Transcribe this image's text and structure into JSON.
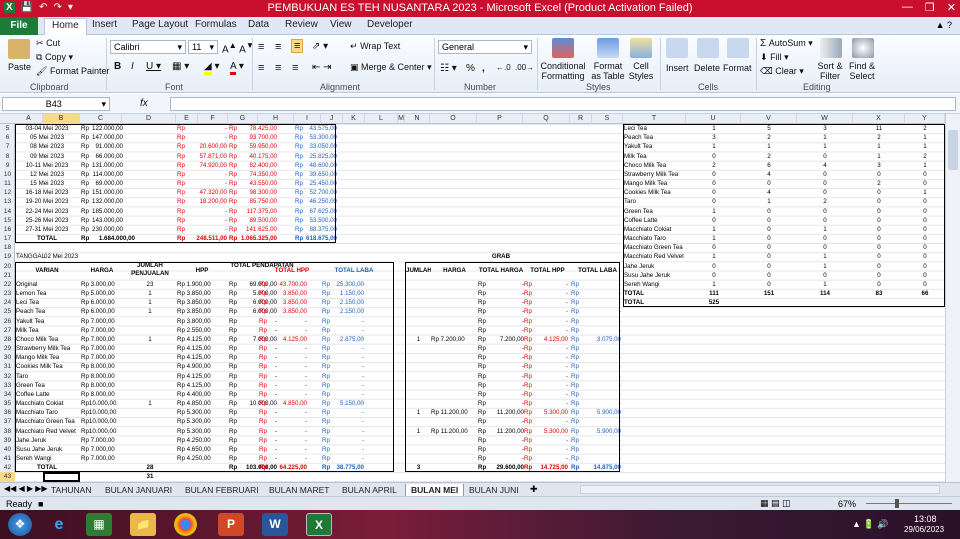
{
  "titlebar": {
    "title": "PEMBUKUAN ES TEH NUSANTARA 2023  -  Microsoft Excel (Product Activation Failed)"
  },
  "ribbon_tabs": [
    "File",
    "Home",
    "Insert",
    "Page Layout",
    "Formulas",
    "Data",
    "Review",
    "View",
    "Developer"
  ],
  "clipboard": {
    "paste": "Paste",
    "cut": "Cut",
    "copy": "Copy",
    "format_painter": "Format Painter",
    "label": "Clipboard"
  },
  "font": {
    "name": "Calibri",
    "size": "11",
    "label": "Font"
  },
  "alignment": {
    "wrap": "Wrap Text",
    "merge": "Merge & Center",
    "label": "Alignment"
  },
  "number": {
    "format": "General",
    "label": "Number"
  },
  "styles": {
    "cond": "Conditional Formatting",
    "table": "Format as Table",
    "cell": "Cell Styles",
    "label": "Styles"
  },
  "cells": {
    "insert": "Insert",
    "delete": "Delete",
    "format": "Format",
    "label": "Cells"
  },
  "editing": {
    "autosum": "AutoSum",
    "fill": "Fill",
    "clear": "Clear",
    "sort": "Sort & Filter",
    "find": "Find & Select",
    "label": "Editing"
  },
  "formula_bar": {
    "name_box": "B43",
    "fx": "fx",
    "content": ""
  },
  "columns": [
    "A",
    "B",
    "C",
    "D",
    "E",
    "F",
    "G",
    "H",
    "I",
    "J",
    "K",
    "L",
    "M",
    "N",
    "O",
    "P",
    "Q",
    "R",
    "S",
    "T",
    "U",
    "V",
    "W",
    "X",
    "Y"
  ],
  "rows": [
    "5",
    "6",
    "7",
    "8",
    "9",
    "10",
    "11",
    "12",
    "13",
    "14",
    "15",
    "16",
    "17",
    "18",
    "19",
    "20",
    "21",
    "22",
    "23",
    "24",
    "25",
    "26",
    "27",
    "28",
    "29",
    "30",
    "31",
    "32",
    "33",
    "34",
    "35",
    "36",
    "37",
    "38",
    "39",
    "40",
    "41",
    "42",
    "43"
  ],
  "top_table": [
    {
      "date": "03-04 Mei 2023",
      "a": "122.000,00",
      "b": "-",
      "c": "78.425,00",
      "d": "43.575,00"
    },
    {
      "date": "05 Mei 2023",
      "a": "147.000,00",
      "b": "-",
      "c": "93.700,00",
      "d": "53.300,00"
    },
    {
      "date": "08 Mei 2023",
      "a": "91.000,00",
      "b": "20.600,00",
      "c": "59.950,00",
      "d": "33.050,00"
    },
    {
      "date": "09 Mei 2023",
      "a": "66.000,00",
      "b": "57.871,00",
      "c": "40.175,00",
      "d": "25.825,00"
    },
    {
      "date": "10-11 Mei 2023",
      "a": "131.000,00",
      "b": "74.920,00",
      "c": "82.400,00",
      "d": "48.600,00"
    },
    {
      "date": "12 Mei 2023",
      "a": "114.000,00",
      "b": "-",
      "c": "74.350,00",
      "d": "39.650,00"
    },
    {
      "date": "15 Mei 2023",
      "a": "69.000,00",
      "b": "-",
      "c": "43.550,00",
      "d": "25.450,00"
    },
    {
      "date": "16-18 Mei 2023",
      "a": "151.000,00",
      "b": "47.320,00",
      "c": "98.300,00",
      "d": "52.700,00"
    },
    {
      "date": "19-20 Mei 2023",
      "a": "132.000,00",
      "b": "18.200,00",
      "c": "85.750,00",
      "d": "46.250,00"
    },
    {
      "date": "22-24 Mei 2023",
      "a": "185.000,00",
      "b": "-",
      "c": "117.375,00",
      "d": "67.625,00"
    },
    {
      "date": "25-26 Mei 2023",
      "a": "143.000,00",
      "b": "-",
      "c": "89.500,00",
      "d": "53.500,00"
    },
    {
      "date": "27-31 Mei 2023",
      "a": "230.000,00",
      "b": "-",
      "c": "141.625,00",
      "d": "88.375,00"
    }
  ],
  "top_total": {
    "label": "TOTAL",
    "a": "1.684.000,00",
    "b": "248.511,00",
    "c": "1.065.325,00",
    "d": "618.675,00"
  },
  "rp": "Rp",
  "tanggal": {
    "label": "TANGGAL",
    "value": "02 Mei 2023"
  },
  "grab_title": "GRAB",
  "headers": {
    "varian": "VARIAN",
    "harga": "HARGA",
    "jumlah": "JUMLAH PENJUALAN",
    "hpp": "HPP",
    "total_pend": "TOTAL PENDAPATAN",
    "total_hpp": "TOTAL HPP",
    "total_laba": "TOTAL LABA",
    "g_jumlah": "JUMLAH",
    "g_harga": "HARGA",
    "g_total_harga": "TOTAL HARGA",
    "g_total_hpp": "TOTAL HPP",
    "g_total_laba": "TOTAL LABA"
  },
  "items": [
    {
      "v": "Original",
      "h": "Rp  3.000,00",
      "j": "23",
      "hpp": "Rp  1.900,00",
      "tp": "69.000,00",
      "th": "43.700,00",
      "tl": "25.300,00",
      "gj": "",
      "gh": "",
      "gth": "-",
      "gthpp": "-",
      "gtl": "-"
    },
    {
      "v": "Lemon Tea",
      "h": "Rp  5.000,00",
      "j": "1",
      "hpp": "Rp  3.850,00",
      "tp": "5.000,00",
      "th": "3.850,00",
      "tl": "1.150,00",
      "gj": "",
      "gh": "",
      "gth": "-",
      "gthpp": "-",
      "gtl": "-"
    },
    {
      "v": "Leci Tea",
      "h": "Rp  6.000,00",
      "j": "1",
      "hpp": "Rp  3.850,00",
      "tp": "6.000,00",
      "th": "3.850,00",
      "tl": "2.150,00",
      "gj": "",
      "gh": "",
      "gth": "-",
      "gthpp": "-",
      "gtl": "-"
    },
    {
      "v": "Peach Tea",
      "h": "Rp  6.000,00",
      "j": "1",
      "hpp": "Rp  3.850,00",
      "tp": "6.000,00",
      "th": "3.850,00",
      "tl": "2.150,00",
      "gj": "",
      "gh": "",
      "gth": "-",
      "gthpp": "-",
      "gtl": "-"
    },
    {
      "v": "Yakult Tea",
      "h": "Rp  7.000,00",
      "j": "",
      "hpp": "Rp  3.800,00",
      "tp": "-",
      "th": "-",
      "tl": "-",
      "gj": "",
      "gh": "",
      "gth": "-",
      "gthpp": "-",
      "gtl": "-"
    },
    {
      "v": "Milk Tea",
      "h": "Rp  7.000,00",
      "j": "",
      "hpp": "Rp  2.550,00",
      "tp": "-",
      "th": "-",
      "tl": "-",
      "gj": "",
      "gh": "",
      "gth": "-",
      "gthpp": "-",
      "gtl": "-"
    },
    {
      "v": "Choco Milk Tea",
      "h": "Rp  7.000,00",
      "j": "1",
      "hpp": "Rp  4.125,00",
      "tp": "7.000,00",
      "th": "4.125,00",
      "tl": "2.875,00",
      "gj": "1",
      "gh": "Rp  7.200,00",
      "gth": "7.200,00",
      "gthpp": "4.125,00",
      "gtl": "3.075,00"
    },
    {
      "v": "Strawberry Milk Tea",
      "h": "Rp  7.000,00",
      "j": "",
      "hpp": "Rp  4.125,00",
      "tp": "-",
      "th": "-",
      "tl": "-",
      "gj": "",
      "gh": "",
      "gth": "-",
      "gthpp": "-",
      "gtl": "-"
    },
    {
      "v": "Mango Milk Tea",
      "h": "Rp  7.000,00",
      "j": "",
      "hpp": "Rp  4.125,00",
      "tp": "-",
      "th": "-",
      "tl": "-",
      "gj": "",
      "gh": "",
      "gth": "-",
      "gthpp": "-",
      "gtl": "-"
    },
    {
      "v": "Cookies Milk Tea",
      "h": "Rp  8.000,00",
      "j": "",
      "hpp": "Rp  4.900,00",
      "tp": "-",
      "th": "-",
      "tl": "-",
      "gj": "",
      "gh": "",
      "gth": "-",
      "gthpp": "-",
      "gtl": "-"
    },
    {
      "v": "Taro",
      "h": "Rp  8.000,00",
      "j": "",
      "hpp": "Rp  4.125,00",
      "tp": "-",
      "th": "-",
      "tl": "-",
      "gj": "",
      "gh": "",
      "gth": "-",
      "gthpp": "-",
      "gtl": "-"
    },
    {
      "v": "Green Tea",
      "h": "Rp  8.000,00",
      "j": "",
      "hpp": "Rp  4.125,00",
      "tp": "-",
      "th": "-",
      "tl": "-",
      "gj": "",
      "gh": "",
      "gth": "-",
      "gthpp": "-",
      "gtl": "-"
    },
    {
      "v": "Coffee Latte",
      "h": "Rp  8.000,00",
      "j": "",
      "hpp": "Rp  4.400,00",
      "tp": "-",
      "th": "-",
      "tl": "-",
      "gj": "",
      "gh": "",
      "gth": "-",
      "gthpp": "-",
      "gtl": "-"
    },
    {
      "v": "Macchiato Cokiat",
      "h": "Rp10.000,00",
      "j": "1",
      "hpp": "Rp  4.850,00",
      "tp": "10.000,00",
      "th": "4.850,00",
      "tl": "5.150,00",
      "gj": "",
      "gh": "",
      "gth": "-",
      "gthpp": "-",
      "gtl": "-"
    },
    {
      "v": "Macchiato Taro",
      "h": "Rp10.000,00",
      "j": "",
      "hpp": "Rp  5.300,00",
      "tp": "-",
      "th": "-",
      "tl": "-",
      "gj": "1",
      "gh": "Rp 11.200,00",
      "gth": "11.200,00",
      "gthpp": "5.300,00",
      "gtl": "5.900,00"
    },
    {
      "v": "Macchiato Green Tea",
      "h": "Rp10.000,00",
      "j": "",
      "hpp": "Rp  5.300,00",
      "tp": "-",
      "th": "-",
      "tl": "-",
      "gj": "",
      "gh": "",
      "gth": "-",
      "gthpp": "-",
      "gtl": "-"
    },
    {
      "v": "Macchiato Red Velvet",
      "h": "Rp10.000,00",
      "j": "",
      "hpp": "Rp  5.300,00",
      "tp": "-",
      "th": "-",
      "tl": "-",
      "gj": "1",
      "gh": "Rp 11.200,00",
      "gth": "11.200,00",
      "gthpp": "5.300,00",
      "gtl": "5.900,00"
    },
    {
      "v": "Jahe Jeruk",
      "h": "Rp  7.000,00",
      "j": "",
      "hpp": "Rp  4.250,00",
      "tp": "-",
      "th": "-",
      "tl": "-",
      "gj": "",
      "gh": "",
      "gth": "-",
      "gthpp": "-",
      "gtl": "-"
    },
    {
      "v": "Susu Jahe Jeruk",
      "h": "Rp  7.000,00",
      "j": "",
      "hpp": "Rp  4.650,00",
      "tp": "-",
      "th": "-",
      "tl": "-",
      "gj": "",
      "gh": "",
      "gth": "-",
      "gthpp": "-",
      "gtl": "-"
    },
    {
      "v": "Sereh Wangi",
      "h": "Rp  7.000,00",
      "j": "",
      "hpp": "Rp  4.250,00",
      "tp": "-",
      "th": "-",
      "tl": "-",
      "gj": "",
      "gh": "",
      "gth": "-",
      "gthpp": "-",
      "gtl": "-"
    }
  ],
  "items_total": {
    "label": "TOTAL",
    "j": "28",
    "tp": "103.000,00",
    "th": "64.225,00",
    "tl": "38.775,00",
    "gj": "3",
    "gth": "29.600,00",
    "gthpp": "14.725,00",
    "gtl": "14.875,00"
  },
  "row43_value": "31",
  "right_table": [
    {
      "n": "Leci Tea",
      "u": "1",
      "v": "5",
      "w": "3",
      "x": "11",
      "y": "2"
    },
    {
      "n": "Peach Tea",
      "u": "3",
      "v": "2",
      "w": "1",
      "x": "2",
      "y": "1"
    },
    {
      "n": "Yakult Tea",
      "u": "1",
      "v": "1",
      "w": "1",
      "x": "1",
      "y": "1"
    },
    {
      "n": "Milk Tea",
      "u": "0",
      "v": "2",
      "w": "0",
      "x": "1",
      "y": "2"
    },
    {
      "n": "Choco Milk Tea",
      "u": "2",
      "v": "6",
      "w": "4",
      "x": "3",
      "y": "1"
    },
    {
      "n": "Strawberry Milk Tea",
      "u": "0",
      "v": "4",
      "w": "0",
      "x": "0",
      "y": "0"
    },
    {
      "n": "Mango Milk Tea",
      "u": "0",
      "v": "0",
      "w": "0",
      "x": "2",
      "y": "0"
    },
    {
      "n": "Cookies Milk Tea",
      "u": "0",
      "v": "4",
      "w": "0",
      "x": "0",
      "y": "1"
    },
    {
      "n": "Taro",
      "u": "0",
      "v": "1",
      "w": "2",
      "x": "0",
      "y": "0"
    },
    {
      "n": "Green Tea",
      "u": "1",
      "v": "0",
      "w": "0",
      "x": "0",
      "y": "0"
    },
    {
      "n": "Coffee Latte",
      "u": "0",
      "v": "0",
      "w": "0",
      "x": "0",
      "y": "0"
    },
    {
      "n": "Macchiato Cokiat",
      "u": "1",
      "v": "0",
      "w": "1",
      "x": "0",
      "y": "0"
    },
    {
      "n": "Macchiato Taro",
      "u": "1",
      "v": "0",
      "w": "0",
      "x": "0",
      "y": "0"
    },
    {
      "n": "Macchiato Green Tea",
      "u": "0",
      "v": "0",
      "w": "0",
      "x": "0",
      "y": "0"
    },
    {
      "n": "Macchiato Red Velvet",
      "u": "1",
      "v": "0",
      "w": "1",
      "x": "0",
      "y": "0"
    },
    {
      "n": "Jahe Jeruk",
      "u": "0",
      "v": "0",
      "w": "1",
      "x": "0",
      "y": "0"
    },
    {
      "n": "Susu Jahe Jeruk",
      "u": "0",
      "v": "0",
      "w": "0",
      "x": "0",
      "y": "0"
    },
    {
      "n": "Sereh Wangi",
      "u": "1",
      "v": "0",
      "w": "1",
      "x": "0",
      "y": "0"
    }
  ],
  "right_total": {
    "n": "TOTAL",
    "u": "111",
    "v": "151",
    "w": "114",
    "x": "83",
    "y": "66"
  },
  "right_grand_total": {
    "n": "TOTAL",
    "u": "525"
  },
  "sheet_tabs": [
    "TAHUNAN",
    "BULAN JANUARI",
    "BULAN FEBRUARI",
    "BULAN MARET",
    "BULAN APRIL",
    "BULAN MEI",
    "BULAN JUNI"
  ],
  "active_sheet": "BULAN MEI",
  "status": {
    "ready": "Ready",
    "zoom": "67%"
  },
  "clock": {
    "time": "13:08",
    "date": "29/06/2023"
  },
  "colors": {
    "excel_green": "#1f7a3a",
    "titlebar_red": "#c8102e",
    "red_text": "#e00000",
    "blue_text": "#1f5fbf"
  }
}
